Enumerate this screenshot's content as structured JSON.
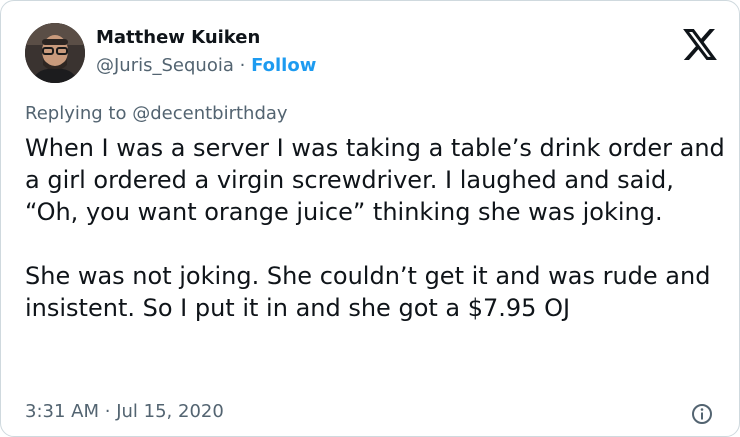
{
  "author": {
    "name": "Matthew Kuiken",
    "handle": "@Juris_Sequoia",
    "separator": "·",
    "follow_label": "Follow"
  },
  "brand": {
    "logo_icon": "x-logo-icon"
  },
  "reply": {
    "prefix": "Replying to",
    "to_handle": "@decentbirthday"
  },
  "tweet": {
    "paragraphs": [
      "When I was a server I was taking a table’s drink order and a girl ordered a virgin screwdriver. I laughed and said, “Oh, you want orange juice” thinking she was joking.",
      "She was not joking. She couldn’t get it and was rude and insistent. So I put it in and she got a $7.95 OJ"
    ]
  },
  "meta": {
    "time": "3:31 AM",
    "separator": "·",
    "date": "Jul 15, 2020",
    "info_icon": "info-icon"
  },
  "colors": {
    "text": "#0f1419",
    "secondary": "#536471",
    "accent": "#1d9bf0",
    "border": "#cfd9de"
  }
}
